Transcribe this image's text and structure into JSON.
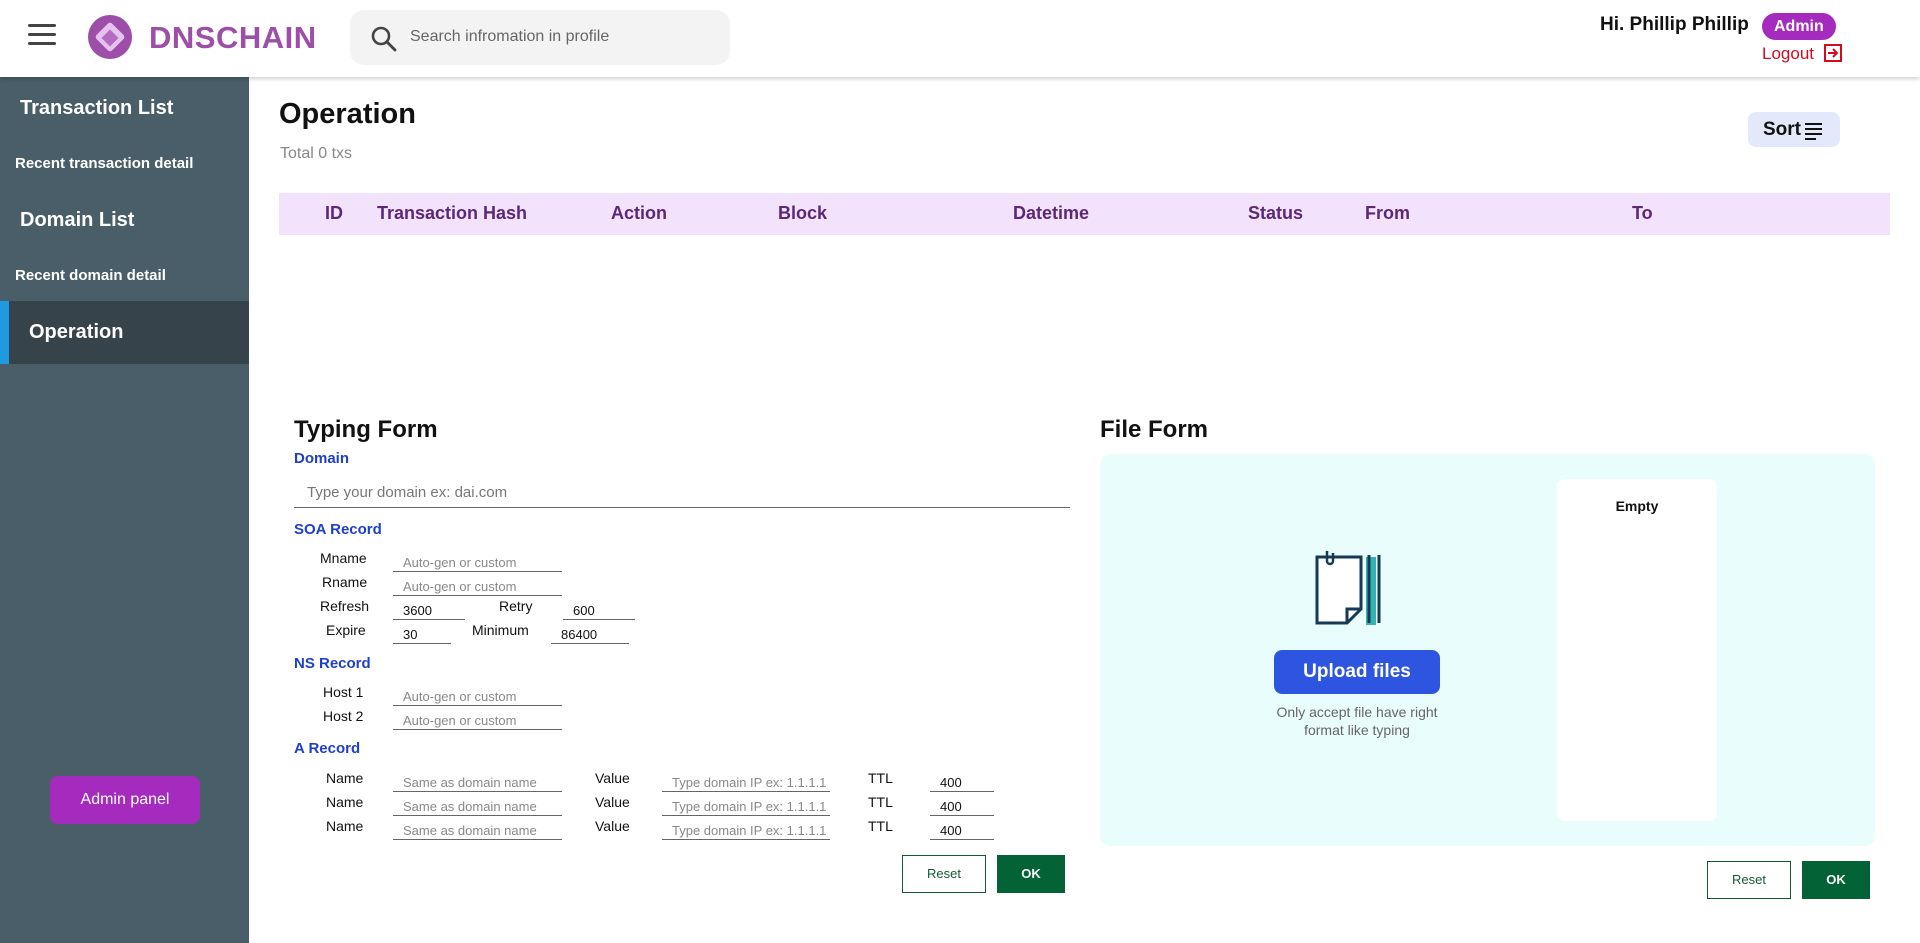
{
  "header": {
    "brand": "DNSCHAIN",
    "search_placeholder": "Search infromation in profile",
    "greeting": "Hi.  Phillip Phillip",
    "role_badge": "Admin",
    "logout_label": "Logout"
  },
  "sidebar": {
    "items": [
      {
        "label": "Transaction List"
      },
      {
        "label": "Recent transaction detail"
      },
      {
        "label": "Domain List"
      },
      {
        "label": "Recent domain detail"
      },
      {
        "label": "Operation"
      }
    ],
    "admin_panel_label": "Admin panel"
  },
  "main": {
    "title": "Operation",
    "total": "Total 0 txs",
    "sort_label": "Sort",
    "columns": [
      "ID",
      "Transaction Hash",
      "Action",
      "Block",
      "Datetime",
      "Status",
      "From",
      "To"
    ]
  },
  "typing_form": {
    "title": "Typing Form",
    "domain_label": "Domain",
    "domain_placeholder": "Type your domain ex: dai.com",
    "soa_label": "SOA Record",
    "mname_label": "Mname",
    "mname_placeholder": "Auto-gen or custom",
    "rname_label": "Rname",
    "rname_placeholder": "Auto-gen or custom",
    "refresh_label": "Refresh",
    "refresh_value": "3600",
    "retry_label": "Retry",
    "retry_value": "600",
    "expire_label": "Expire",
    "expire_value": "30",
    "minimum_label": "Minimum",
    "minimum_value": "86400",
    "ns_label": "NS Record",
    "host1_label": "Host 1",
    "host1_placeholder": "Auto-gen or custom",
    "host2_label": "Host 2",
    "host2_placeholder": "Auto-gen or custom",
    "a_label": "A Record",
    "a_rows": [
      {
        "name_label": "Name",
        "name_placeholder": "Same as domain name",
        "value_label": "Value",
        "value_placeholder": "Type domain IP ex: 1.1.1.1",
        "ttl_label": "TTL",
        "ttl_value": "400"
      },
      {
        "name_label": "Name",
        "name_placeholder": "Same as domain name",
        "value_label": "Value",
        "value_placeholder": "Type domain IP ex: 1.1.1.1",
        "ttl_label": "TTL",
        "ttl_value": "400"
      },
      {
        "name_label": "Name",
        "name_placeholder": "Same as domain name",
        "value_label": "Value",
        "value_placeholder": "Type domain IP ex: 1.1.1.1",
        "ttl_label": "TTL",
        "ttl_value": "400"
      }
    ],
    "reset_label": "Reset",
    "ok_label": "OK"
  },
  "file_form": {
    "title": "File Form",
    "upload_label": "Upload files",
    "note": "Only accept file have right format like typing",
    "empty_label": "Empty",
    "reset_label": "Reset",
    "ok_label": "OK"
  },
  "colors": {
    "brand": "#9c4ea8",
    "sidebar": "#4a5e69",
    "accent_purple": "#a52bbe",
    "table_header": "#f2e2fb",
    "ok_green": "#046336",
    "upload_blue": "#2e55e0"
  }
}
